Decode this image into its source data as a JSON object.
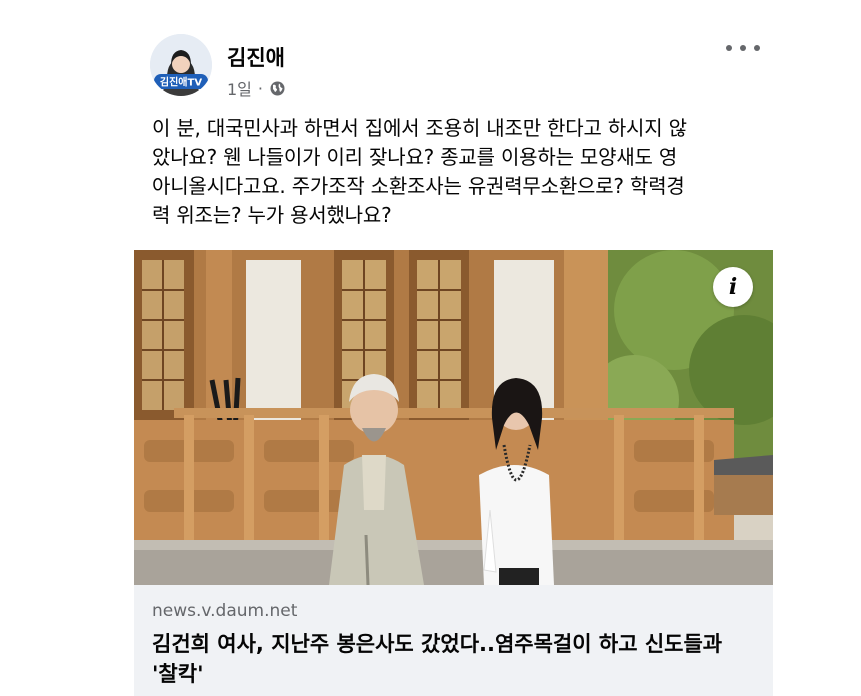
{
  "post": {
    "author": "김진애",
    "avatar_caption": "김진애TV",
    "time": "1일",
    "separator": "·",
    "privacy_icon": "globe-icon",
    "more_icon": "more-options-icon",
    "text_lines": [
      "이 분, 대국민사과 하면서 집에서 조용히 내조만 한다고 하시지 않",
      "았나요? 웬 나들이가 이리 잦나요? 종교를 이용하는 모양새도  영",
      "아니올시다고요. 주가조작 소환조사는 유권력무소환으로? 학력경",
      "력 위조는? 누가 용서했나요?"
    ]
  },
  "link": {
    "domain": "news.v.daum.net",
    "headline_lines": [
      "김건희 여사, 지난주 봉은사도 갔었다..염주목걸이 하고 신도들과",
      "'찰칵'"
    ],
    "info_icon": "info-icon",
    "info_label": "i"
  },
  "colors": {
    "text": "#050505",
    "secondary": "#65676b",
    "card_bg": "#f0f2f5",
    "avatar_badge": "#1f5fb8"
  }
}
